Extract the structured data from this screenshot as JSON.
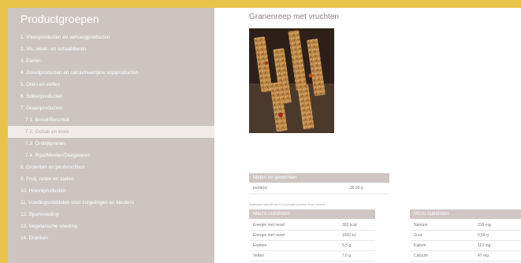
{
  "sidebar": {
    "title": "Productgroepen",
    "items": [
      {
        "label": "1. Vleesproducten en vervangproducten",
        "sub": false,
        "active": false
      },
      {
        "label": "2. Vis, week- en schaaldieren",
        "sub": false,
        "active": false
      },
      {
        "label": "3. Eieren",
        "sub": false,
        "active": false
      },
      {
        "label": "4. Zuivelproducten en calciumverrijkte sojaproducten",
        "sub": false,
        "active": false
      },
      {
        "label": "5. Oliën en vetten",
        "sub": false,
        "active": false
      },
      {
        "label": "6. Suikerproducten",
        "sub": false,
        "active": false
      },
      {
        "label": "7. Graanproducten",
        "sub": false,
        "active": false
      },
      {
        "label": "7.1. Brood/Beschuit",
        "sub": true,
        "active": false
      },
      {
        "label": "7.2. Gebak en koek",
        "sub": true,
        "active": true
      },
      {
        "label": "7.3. Ontbijtgranen",
        "sub": true,
        "active": false
      },
      {
        "label": "7.4. Rijst/Meelen/Deegwaren",
        "sub": true,
        "active": false
      },
      {
        "label": "8. Groenten en peulvruchten",
        "sub": false,
        "active": false
      },
      {
        "label": "9. Fruit, noten en zaden",
        "sub": false,
        "active": false
      },
      {
        "label": "10. Hoeveproducten",
        "sub": false,
        "active": false
      },
      {
        "label": "11. Voedingsmiddelen voor zuigelingen en kleuters",
        "sub": false,
        "active": false
      },
      {
        "label": "12. Sportvoeding",
        "sub": false,
        "active": false
      },
      {
        "label": "13. Vegetarische voeding",
        "sub": false,
        "active": false
      },
      {
        "label": "14. Dranken",
        "sub": false,
        "active": false
      }
    ]
  },
  "product": {
    "title": "Granenreep met vruchten",
    "photo_icon": "granola-bars-photo"
  },
  "weights": {
    "header": "Maten en gewichten",
    "row_label": "portie(s)",
    "row_value": "35,00 g",
    "note": "Nutritionele waarden per 100 g behalve gedeelte of per 'eenheid'"
  },
  "macro": {
    "header": "Macro-nutriënten",
    "rows": [
      {
        "label": "Energie met vezel",
        "value": "393 kcal"
      },
      {
        "label": "Energie met vezel",
        "value": "1660 kJ"
      },
      {
        "label": "Eiwitten",
        "value": "5,5 g"
      },
      {
        "label": "Vetten",
        "value": "7,6 g"
      }
    ]
  },
  "micro": {
    "header": "Micro-nutriënten",
    "rows": [
      {
        "label": "Natrium",
        "value": "216 mg"
      },
      {
        "label": "Zout",
        "value": "0,54 g"
      },
      {
        "label": "Kalium",
        "value": "113 mg"
      },
      {
        "label": "Calcium",
        "value": "47 mg"
      }
    ]
  },
  "colors": {
    "background": "#e8c44a",
    "sidebar": "#cdc4c2",
    "active_item": "#f1ecea",
    "header": "#d0c6c4"
  }
}
